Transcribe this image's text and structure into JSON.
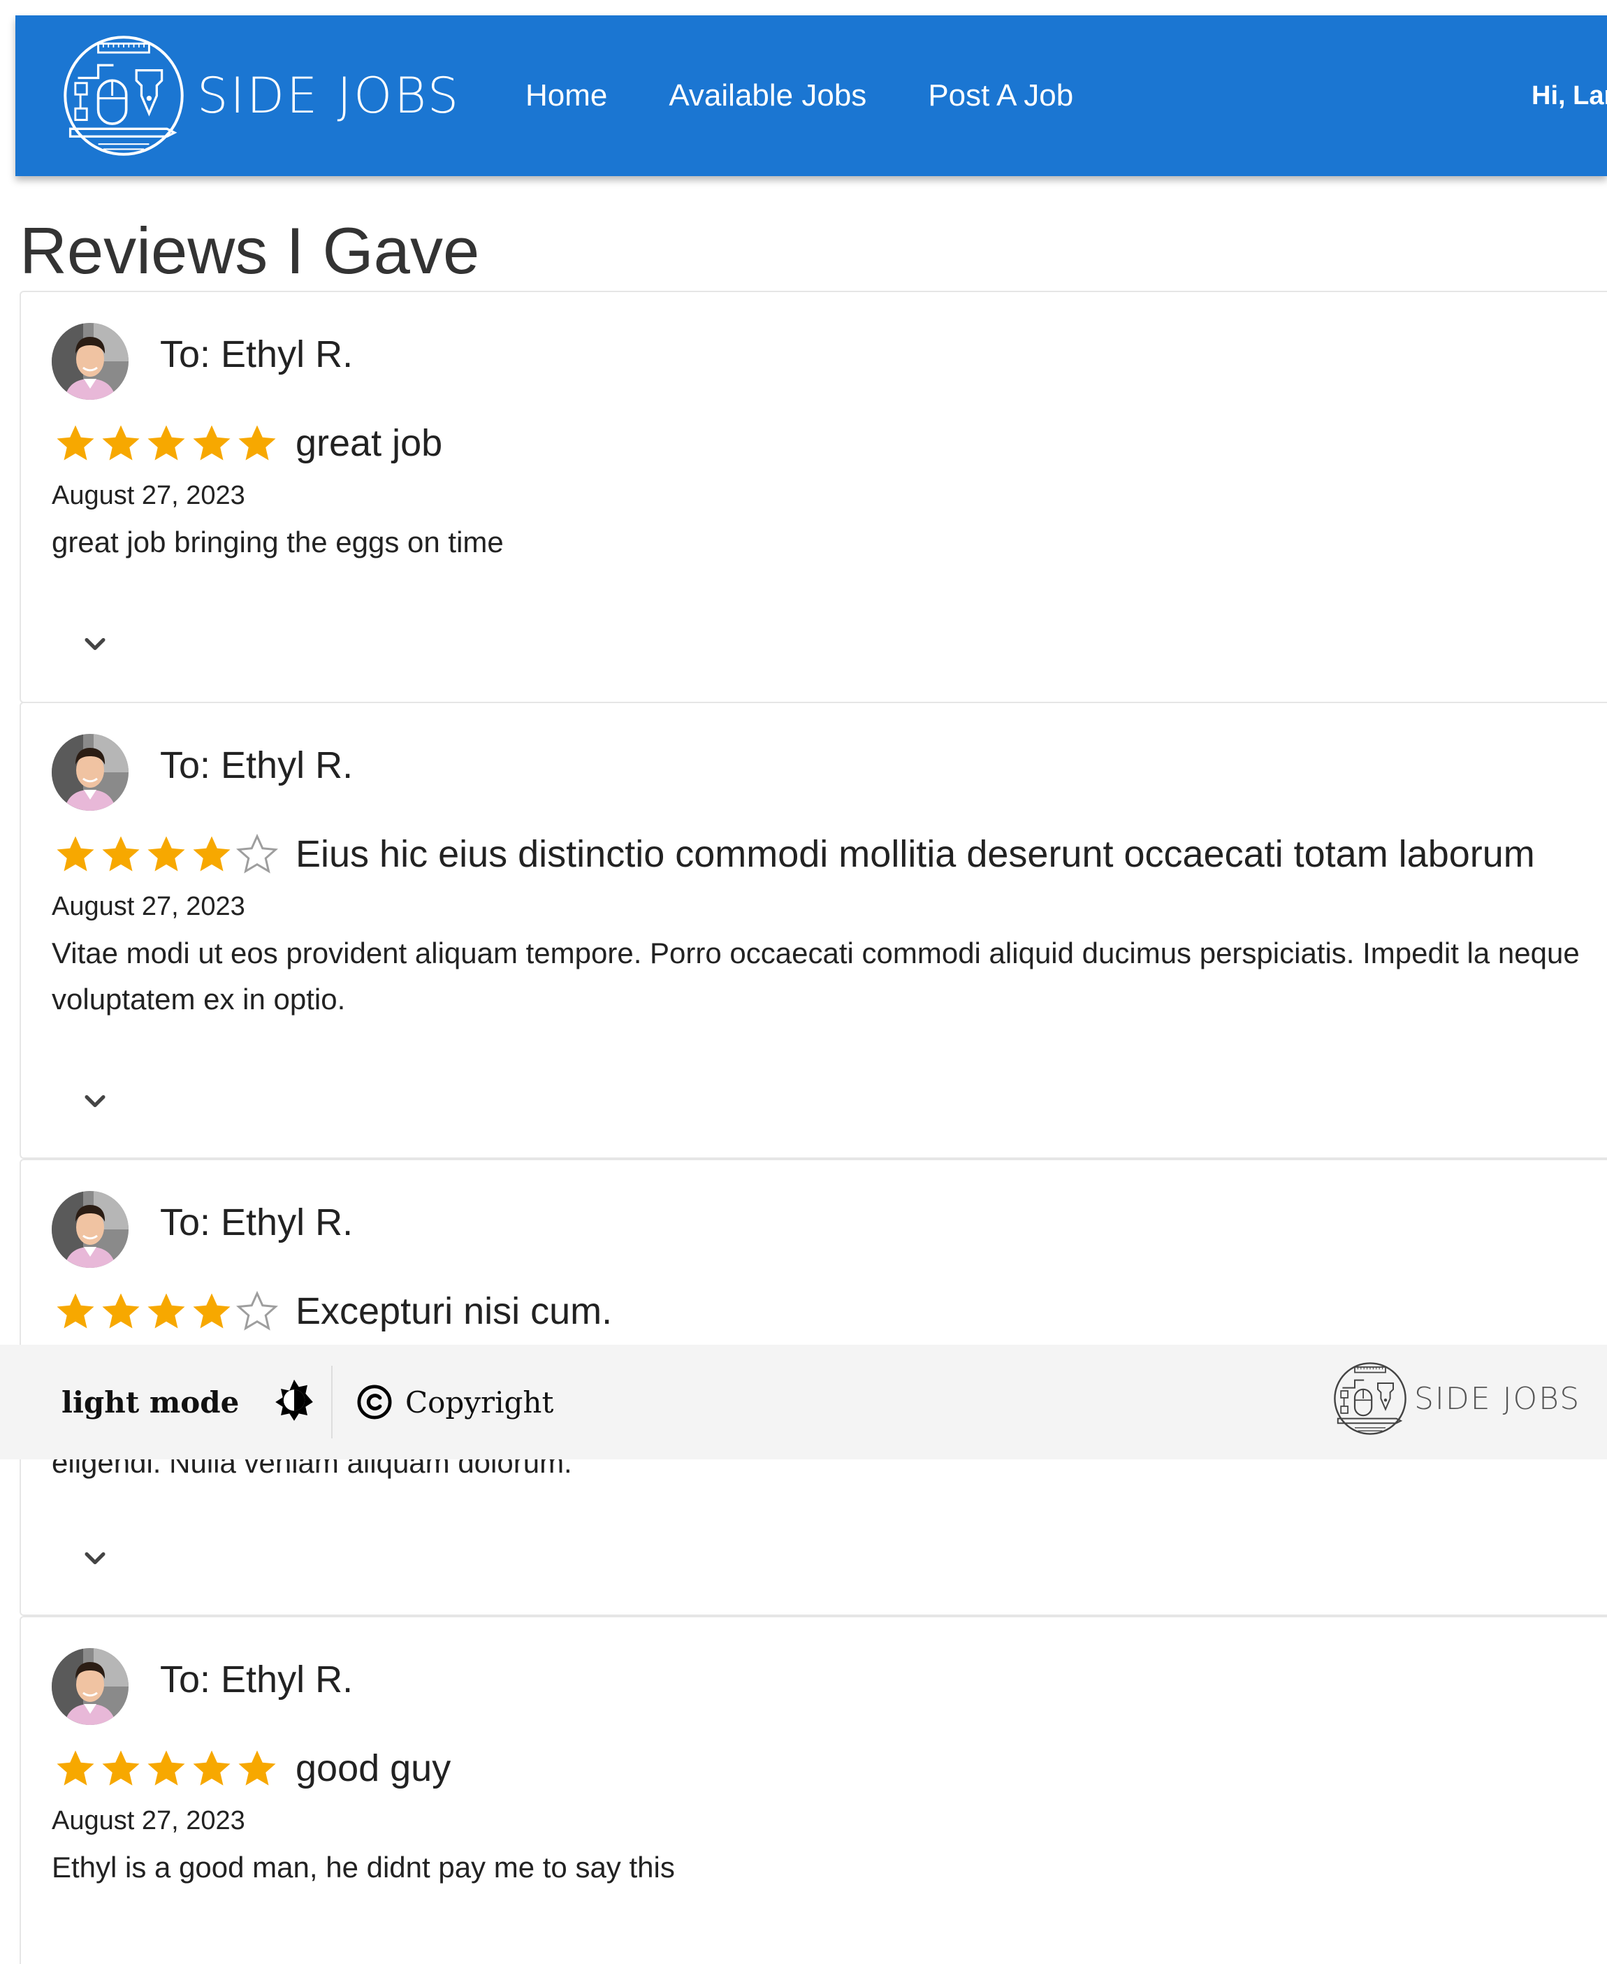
{
  "header": {
    "brand": "SIDE JOBS",
    "nav": [
      "Home",
      "Available Jobs",
      "Post A Job"
    ],
    "greeting": "Hi, Larr"
  },
  "page_title": "Reviews I Gave",
  "reviews": [
    {
      "to": "To: Ethyl R.",
      "rating": 5,
      "title": "great job",
      "date": "August 27, 2023",
      "body": "great job bringing the eggs on time"
    },
    {
      "to": "To: Ethyl R.",
      "rating": 4,
      "title": "Eius hic eius distinctio commodi mollitia deserunt occaecati totam laborum",
      "date": "August 27, 2023",
      "body": "Vitae modi ut eos provident aliquam tempore. Porro occaecati commodi aliquid ducimus perspiciatis. Impedit la neque voluptatem ex in optio."
    },
    {
      "to": "To: Ethyl R.",
      "rating": 4,
      "title": "Excepturi nisi cum.",
      "date": "",
      "body": "eligendi. Nulla veniam aliquam dolorum."
    },
    {
      "to": "To: Ethyl R.",
      "rating": 5,
      "title": "good guy",
      "date": "August 27, 2023",
      "body": "Ethyl is a good man, he didnt pay me to say this"
    }
  ],
  "footer": {
    "theme_label": "light mode",
    "copyright": "Copyright",
    "brand": "SIDE JOBS"
  },
  "colors": {
    "navbar": "#1b76d2",
    "star_filled": "#f7a800",
    "star_empty_outline": "#9e9e9e",
    "footer_bg": "#f4f4f4"
  },
  "icons": {
    "brand_logo": "side-jobs-logo-icon",
    "star": "star-icon",
    "expand": "chevron-down-icon",
    "theme": "contrast-sun-icon",
    "copyright": "copyright-icon"
  }
}
